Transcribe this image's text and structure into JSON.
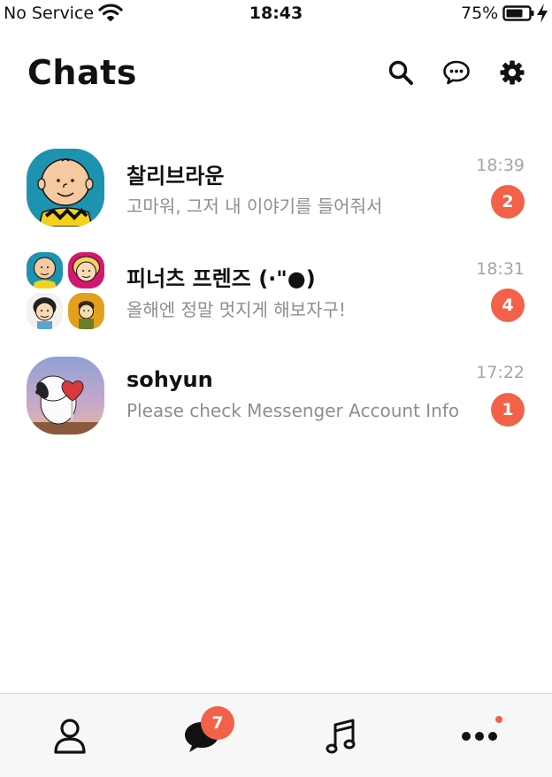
{
  "status_bar": {
    "carrier": "No Service",
    "time": "18:43",
    "battery_percent": "75%",
    "battery_level": 0.75,
    "icons": [
      "wifi-icon",
      "battery-icon",
      "charging-bolt-icon"
    ]
  },
  "header": {
    "title": "Chats",
    "icons": [
      "search-icon",
      "new-chat-icon",
      "settings-gear-icon"
    ]
  },
  "chats": [
    {
      "name": "찰리브라운",
      "preview": "고마워, 그저 내 이야기를 들어줘서",
      "time": "18:39",
      "unread": "2"
    },
    {
      "name": "피너츠 프렌즈 (·\"●)",
      "preview": "올해엔 정말 멋지게 해보자구!",
      "time": "18:31",
      "unread": "4"
    },
    {
      "name": "sohyun",
      "preview": "Please check Messenger Account Info",
      "time": "17:22",
      "unread": "1"
    }
  ],
  "tab_bar": {
    "tabs": [
      "friends-tab",
      "chats-tab",
      "music-tab",
      "more-tab"
    ],
    "chats_badge": "7",
    "accent_color": "#f26148"
  }
}
